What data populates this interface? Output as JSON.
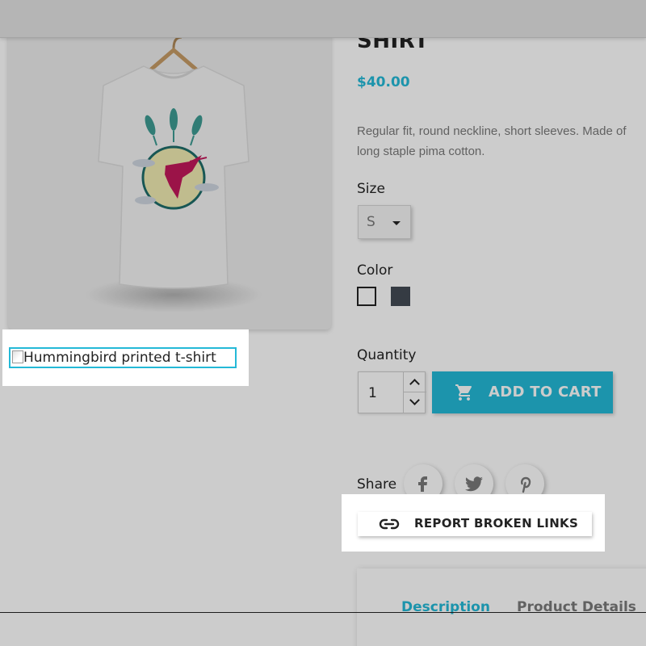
{
  "product": {
    "title": "SHIRT",
    "price": "$40.00",
    "description_line1": "Regular fit, round neckline, short sleeves. Made of",
    "description_line2": "long staple pima cotton.",
    "image_alt": "Hummingbird printed t-shirt"
  },
  "variants": {
    "size_label": "Size",
    "size_value": "S",
    "color_label": "Color",
    "colors": [
      {
        "name": "White",
        "hex": "#ffffff"
      },
      {
        "name": "Black",
        "hex": "#434a54"
      }
    ]
  },
  "cart": {
    "quantity_label": "Quantity",
    "quantity_value": "1",
    "add_to_cart_label": "ADD TO CART"
  },
  "share": {
    "label": "Share",
    "networks": [
      "facebook-icon",
      "twitter-icon",
      "pinterest-icon"
    ]
  },
  "report": {
    "label": "REPORT BROKEN LINKS"
  },
  "tabs": [
    {
      "label": "Description",
      "active": true
    },
    {
      "label": "Product Details",
      "active": false
    }
  ],
  "colors": {
    "accent": "#24b9d7",
    "text": "#232323",
    "muted": "#7a7a7a"
  }
}
